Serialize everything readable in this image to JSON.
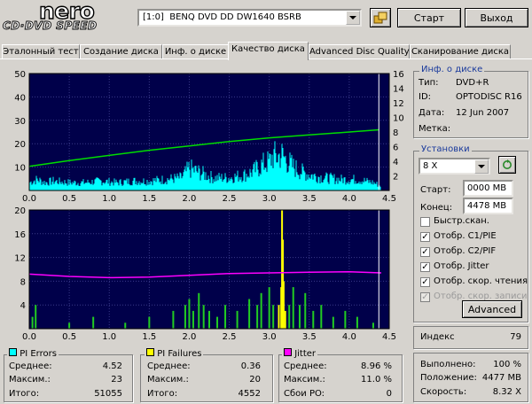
{
  "logo": {
    "brand": "nero",
    "product": "CD·DVD SPEED"
  },
  "drive": {
    "label": "[1:0]  BENQ DVD DD DW1640 BSRB"
  },
  "buttons": {
    "start": "Старт",
    "exit": "Выход",
    "advanced": "Advanced"
  },
  "tabs": [
    {
      "label": "Эталонный тест"
    },
    {
      "label": "Создание диска"
    },
    {
      "label": "Инф. о диске"
    },
    {
      "label": "Качество диска"
    },
    {
      "label": "Advanced Disc Quality"
    },
    {
      "label": "Сканирование диска"
    }
  ],
  "disc_info": {
    "title": "Инф. о диске",
    "type_label": "Тип:",
    "type_value": "DVD+R",
    "id_label": "ID:",
    "id_value": "OPTODISC R16",
    "date_label": "Дата:",
    "date_value": "12 Jun 2007",
    "mark_label": "Метка:",
    "mark_value": ""
  },
  "settings": {
    "title": "Установки",
    "speed": "8 X",
    "start_label": "Старт:",
    "start_value": "0000 MB",
    "end_label": "Конец:",
    "end_value": "4478 MB",
    "checkboxes": [
      {
        "label": "Быстр.скан.",
        "checked": false,
        "disabled": false
      },
      {
        "label": "Отобр. C1/PIE",
        "checked": true,
        "disabled": false
      },
      {
        "label": "Отобр. C2/PIF",
        "checked": true,
        "disabled": false
      },
      {
        "label": "Отобр. Jitter",
        "checked": true,
        "disabled": false
      },
      {
        "label": "Отобр. скор. чтения",
        "checked": true,
        "disabled": false
      },
      {
        "label": "Отобр. скор. записи",
        "checked": true,
        "disabled": true
      }
    ]
  },
  "index": {
    "label": "Индекс",
    "value": "79"
  },
  "progress": {
    "done_label": "Выполнено:",
    "done_value": "100 %",
    "position_label": "Положение:",
    "position_value": "4477 MB",
    "speed_label": "Скорость:",
    "speed_value": "8.32 X"
  },
  "stats": {
    "pie": {
      "title": "PI Errors",
      "color": "#00ffff",
      "avg_label": "Среднее:",
      "avg": "4.52",
      "max_label": "Максим.:",
      "max": "23",
      "total_label": "Итого:",
      "total": "51055"
    },
    "pif": {
      "title": "PI Failures",
      "color": "#ffff00",
      "avg_label": "Среднее:",
      "avg": "0.36",
      "max_label": "Максим.:",
      "max": "20",
      "total_label": "Итого:",
      "total": "4552"
    },
    "jitter": {
      "title": "Jitter",
      "color": "#ff00ff",
      "avg_label": "Среднее:",
      "avg": "8.96 %",
      "max_label": "Максим.:",
      "max": "11.0 %",
      "po_label": "Сбои PO:",
      "po": "0"
    }
  },
  "chart_data": [
    {
      "type": "area",
      "xlim": [
        0,
        4.5
      ],
      "ylim": [
        0,
        50
      ],
      "y2lim": [
        0,
        16
      ],
      "x_ticks": [
        "0.0",
        "0.5",
        "1.0",
        "1.5",
        "2.0",
        "2.5",
        "3.0",
        "3.5",
        "4.0",
        "4.5"
      ],
      "y_ticks": [
        "50",
        "40",
        "30",
        "20",
        "10"
      ],
      "y2_ticks": [
        "16",
        "14",
        "12",
        "10",
        "8",
        "6",
        "4",
        "2"
      ],
      "grid": true,
      "pie_envelope": [
        [
          0,
          5
        ],
        [
          0.1,
          7
        ],
        [
          0.2,
          5
        ],
        [
          0.3,
          6
        ],
        [
          0.5,
          5
        ],
        [
          0.7,
          5
        ],
        [
          0.9,
          6
        ],
        [
          1.1,
          5
        ],
        [
          1.3,
          6
        ],
        [
          1.5,
          6
        ],
        [
          1.7,
          7
        ],
        [
          1.9,
          8
        ],
        [
          2.0,
          14
        ],
        [
          2.1,
          12
        ],
        [
          2.2,
          10
        ],
        [
          2.3,
          8
        ],
        [
          2.5,
          8
        ],
        [
          2.7,
          10
        ],
        [
          2.8,
          12
        ],
        [
          2.9,
          16
        ],
        [
          3.0,
          18
        ],
        [
          3.05,
          22
        ],
        [
          3.1,
          21
        ],
        [
          3.15,
          23
        ],
        [
          3.2,
          20
        ],
        [
          3.3,
          15
        ],
        [
          3.4,
          12
        ],
        [
          3.5,
          10
        ],
        [
          3.7,
          8
        ],
        [
          3.9,
          7
        ],
        [
          4.1,
          7
        ],
        [
          4.3,
          5
        ],
        [
          4.4,
          3
        ]
      ],
      "read_speed": [
        [
          0,
          3.3
        ],
        [
          0.5,
          4.1
        ],
        [
          1.0,
          4.8
        ],
        [
          1.5,
          5.5
        ],
        [
          2.0,
          6.1
        ],
        [
          2.5,
          6.7
        ],
        [
          3.0,
          7.2
        ],
        [
          3.5,
          7.6
        ],
        [
          4.0,
          8.0
        ],
        [
          4.37,
          8.3
        ]
      ]
    },
    {
      "type": "bar",
      "xlim": [
        0,
        4.5
      ],
      "ylim": [
        0,
        20
      ],
      "x_ticks": [
        "0.0",
        "0.5",
        "1.0",
        "1.5",
        "2.0",
        "2.5",
        "3.0",
        "3.5",
        "4.0",
        "4.5"
      ],
      "y_ticks": [
        "20",
        "16",
        "12",
        "8",
        "4"
      ],
      "grid": true,
      "pif_yellow": [
        [
          3.12,
          4
        ],
        [
          3.15,
          7
        ],
        [
          3.16,
          20
        ],
        [
          3.17,
          15
        ],
        [
          3.18,
          8
        ],
        [
          3.2,
          3
        ]
      ],
      "pif_green": [
        [
          0.04,
          2
        ],
        [
          0.08,
          4
        ],
        [
          0.5,
          1
        ],
        [
          0.8,
          2
        ],
        [
          1.2,
          1
        ],
        [
          1.5,
          2
        ],
        [
          1.8,
          3
        ],
        [
          1.95,
          4
        ],
        [
          2.0,
          5
        ],
        [
          2.05,
          3
        ],
        [
          2.12,
          6
        ],
        [
          2.18,
          4
        ],
        [
          2.25,
          3
        ],
        [
          2.35,
          2
        ],
        [
          2.45,
          4
        ],
        [
          2.6,
          3
        ],
        [
          2.75,
          5
        ],
        [
          2.85,
          4
        ],
        [
          2.9,
          6
        ],
        [
          3.0,
          7
        ],
        [
          3.05,
          4
        ],
        [
          3.25,
          4
        ],
        [
          3.3,
          7
        ],
        [
          3.38,
          4
        ],
        [
          3.45,
          6
        ],
        [
          3.55,
          3
        ],
        [
          3.65,
          4
        ],
        [
          3.8,
          2
        ],
        [
          3.95,
          3
        ],
        [
          4.1,
          2
        ],
        [
          4.3,
          1
        ]
      ],
      "jitter": [
        [
          0,
          9.2
        ],
        [
          0.5,
          8.8
        ],
        [
          1.0,
          8.6
        ],
        [
          1.5,
          8.7
        ],
        [
          2.0,
          9.0
        ],
        [
          2.5,
          9.3
        ],
        [
          3.0,
          9.4
        ],
        [
          3.5,
          9.5
        ],
        [
          4.0,
          9.6
        ],
        [
          4.4,
          9.4
        ]
      ]
    }
  ]
}
